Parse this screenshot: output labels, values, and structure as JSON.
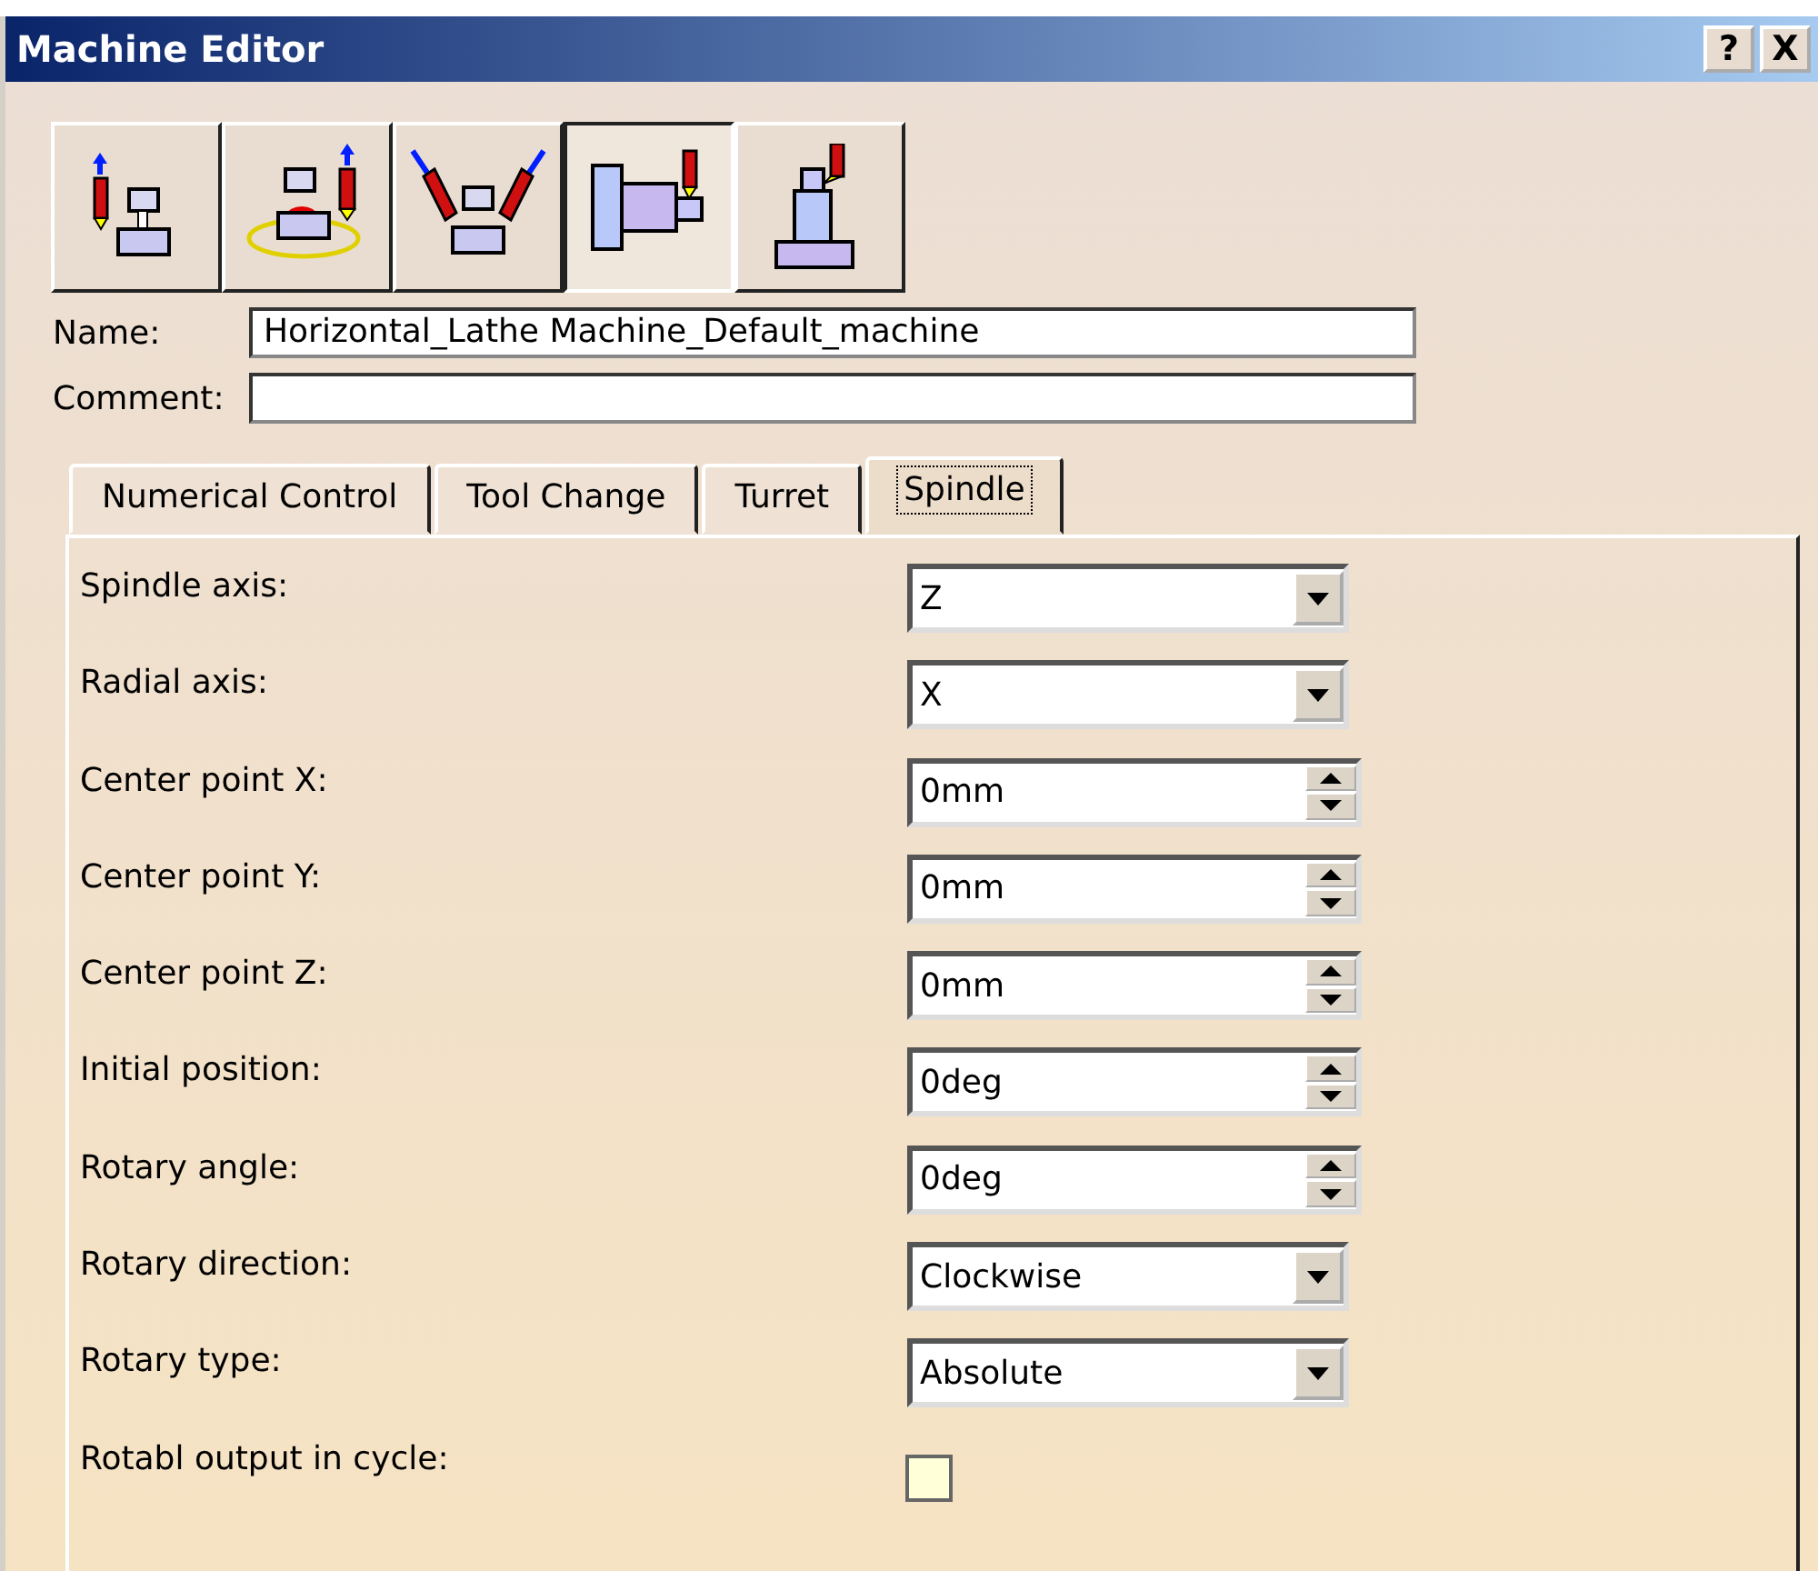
{
  "window": {
    "title": "Machine Editor",
    "buttons": [
      "?",
      "X"
    ]
  },
  "toolbar": [
    {
      "kind": "axis",
      "selected": false
    },
    {
      "kind": "rotary",
      "selected": false
    },
    {
      "kind": "tilt",
      "selected": false
    },
    {
      "kind": "lathe",
      "selected": true
    },
    {
      "kind": "mill",
      "selected": false
    }
  ],
  "name": {
    "label": "Name:",
    "value": "Horizontal_Lathe Machine_Default_machine"
  },
  "comment": {
    "label": "Comment:"
  },
  "tabs": [
    {
      "label": "Numerical Control",
      "selected": false
    },
    {
      "label": "Tool Change",
      "selected": false
    },
    {
      "label": "Turret",
      "selected": false
    },
    {
      "label": "Spindle",
      "selected": true
    }
  ],
  "rows": [
    {
      "kind": "dropdown",
      "label": "Spindle axis:",
      "value": "Z"
    },
    {
      "kind": "dropdown",
      "label": "Radial axis:",
      "value": "X"
    },
    {
      "kind": "spinner",
      "label": "Center point X:",
      "value": "0mm"
    },
    {
      "kind": "spinner",
      "label": "Center point Y:",
      "value": "0mm"
    },
    {
      "kind": "spinner",
      "label": "Center point Z:",
      "value": "0mm"
    },
    {
      "kind": "spinner",
      "label": "Initial position:",
      "value": "0deg"
    },
    {
      "kind": "spinner",
      "label": "Rotary angle:",
      "value": "0deg"
    },
    {
      "kind": "dropdown",
      "label": "Rotary direction:",
      "value": "Clockwise"
    },
    {
      "kind": "dropdown",
      "label": "Rotary type:",
      "value": "Absolute"
    },
    {
      "kind": "checkbox",
      "label": "Rotabl output in cycle:",
      "checked": false
    }
  ]
}
